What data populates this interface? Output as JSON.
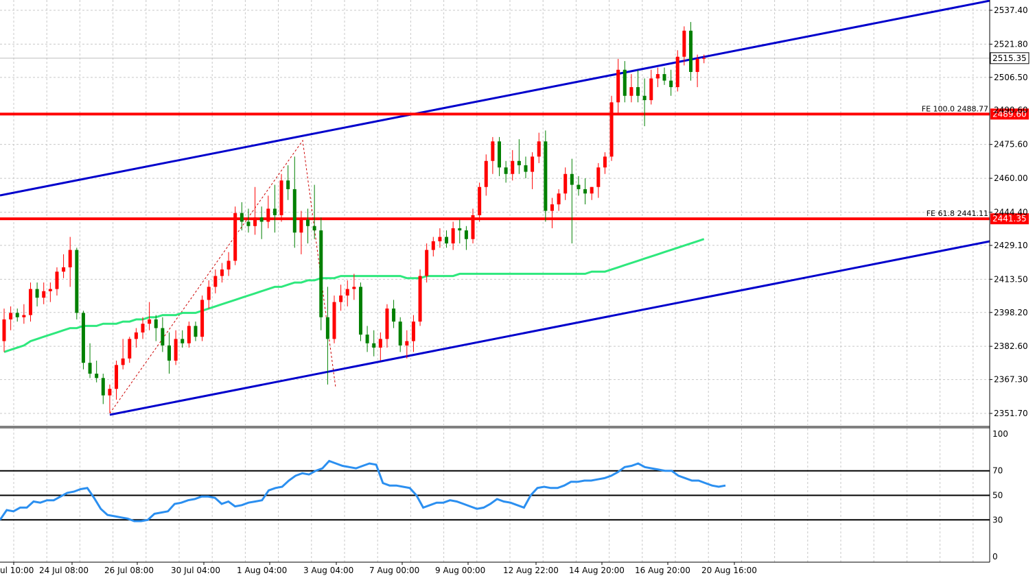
{
  "chart_data": [
    {
      "type": "candlestick",
      "symbol_panel": "price",
      "y_ticks": [
        "2537.40",
        "2521.80",
        "2506.50",
        "2475.60",
        "2460.00",
        "2444.40",
        "2429.10",
        "2413.50",
        "2398.20",
        "2382.60",
        "2367.30",
        "2351.70"
      ],
      "y_range": [
        2345,
        2543
      ],
      "x_labels": [
        "ul 10:00",
        "24 Jul 08:00",
        "26 Jul 08:00",
        "30 Jul 04:00",
        "1 Aug 04:00",
        "3 Aug 04:00",
        "7 Aug 00:00",
        "9 Aug 00:00",
        "12 Aug 22:00",
        "14 Aug 20:00",
        "16 Aug 20:00",
        "20 Aug 16:00"
      ],
      "current_price": "2515.35",
      "price_levels": [
        {
          "value": 2489.6,
          "label": "2489.60",
          "fib_label": "FE 100.0 2488.77",
          "hidden_tick": "2490.60",
          "color": "#ff0000"
        },
        {
          "value": 2441.35,
          "label": "2441.35",
          "fib_label": "FE 61.8 2441.11",
          "color": "#ff0000"
        }
      ],
      "colors": {
        "up": "#ff0000",
        "down": "#008000",
        "ma": "#2ee87d",
        "channel": "#0000cc",
        "level": "#ff0000",
        "fib_zigzag": "#cc0000"
      },
      "candles": [
        {
          "o": 2385,
          "h": 2400,
          "l": 2380,
          "c": 2395
        },
        {
          "o": 2395,
          "h": 2401,
          "l": 2390,
          "c": 2398
        },
        {
          "o": 2398,
          "h": 2400,
          "l": 2394,
          "c": 2396
        },
        {
          "o": 2396,
          "h": 2402,
          "l": 2393,
          "c": 2397
        },
        {
          "o": 2397,
          "h": 2412,
          "l": 2394,
          "c": 2409
        },
        {
          "o": 2409,
          "h": 2412,
          "l": 2401,
          "c": 2405
        },
        {
          "o": 2405,
          "h": 2412,
          "l": 2402,
          "c": 2408
        },
        {
          "o": 2408,
          "h": 2412,
          "l": 2403,
          "c": 2409
        },
        {
          "o": 2409,
          "h": 2419,
          "l": 2406,
          "c": 2417
        },
        {
          "o": 2417,
          "h": 2425,
          "l": 2414,
          "c": 2419
        },
        {
          "o": 2419,
          "h": 2433,
          "l": 2410,
          "c": 2427
        },
        {
          "o": 2427,
          "h": 2428,
          "l": 2395,
          "c": 2398
        },
        {
          "o": 2398,
          "h": 2399,
          "l": 2372,
          "c": 2375
        },
        {
          "o": 2375,
          "h": 2384,
          "l": 2368,
          "c": 2370
        },
        {
          "o": 2370,
          "h": 2376,
          "l": 2366,
          "c": 2368
        },
        {
          "o": 2368,
          "h": 2370,
          "l": 2356,
          "c": 2360
        },
        {
          "o": 2360,
          "h": 2365,
          "l": 2352,
          "c": 2363
        },
        {
          "o": 2363,
          "h": 2376,
          "l": 2358,
          "c": 2374
        },
        {
          "o": 2374,
          "h": 2386,
          "l": 2372,
          "c": 2377
        },
        {
          "o": 2377,
          "h": 2387,
          "l": 2375,
          "c": 2386
        },
        {
          "o": 2386,
          "h": 2391,
          "l": 2382,
          "c": 2389
        },
        {
          "o": 2389,
          "h": 2396,
          "l": 2386,
          "c": 2393
        },
        {
          "o": 2393,
          "h": 2403,
          "l": 2390,
          "c": 2395
        },
        {
          "o": 2395,
          "h": 2397,
          "l": 2385,
          "c": 2391
        },
        {
          "o": 2391,
          "h": 2396,
          "l": 2380,
          "c": 2383
        },
        {
          "o": 2383,
          "h": 2389,
          "l": 2370,
          "c": 2376
        },
        {
          "o": 2376,
          "h": 2390,
          "l": 2374,
          "c": 2386
        },
        {
          "o": 2386,
          "h": 2390,
          "l": 2382,
          "c": 2384
        },
        {
          "o": 2384,
          "h": 2394,
          "l": 2382,
          "c": 2392
        },
        {
          "o": 2392,
          "h": 2394,
          "l": 2385,
          "c": 2387
        },
        {
          "o": 2387,
          "h": 2406,
          "l": 2385,
          "c": 2404
        },
        {
          "o": 2404,
          "h": 2413,
          "l": 2400,
          "c": 2410
        },
        {
          "o": 2410,
          "h": 2418,
          "l": 2407,
          "c": 2415
        },
        {
          "o": 2415,
          "h": 2421,
          "l": 2412,
          "c": 2418
        },
        {
          "o": 2418,
          "h": 2426,
          "l": 2415,
          "c": 2422
        },
        {
          "o": 2422,
          "h": 2447,
          "l": 2420,
          "c": 2444
        },
        {
          "o": 2444,
          "h": 2449,
          "l": 2436,
          "c": 2440
        },
        {
          "o": 2440,
          "h": 2446,
          "l": 2435,
          "c": 2438
        },
        {
          "o": 2438,
          "h": 2456,
          "l": 2434,
          "c": 2442
        },
        {
          "o": 2442,
          "h": 2447,
          "l": 2432,
          "c": 2440
        },
        {
          "o": 2440,
          "h": 2452,
          "l": 2437,
          "c": 2446
        },
        {
          "o": 2446,
          "h": 2457,
          "l": 2435,
          "c": 2443
        },
        {
          "o": 2443,
          "h": 2462,
          "l": 2440,
          "c": 2459
        },
        {
          "o": 2459,
          "h": 2466,
          "l": 2450,
          "c": 2455
        },
        {
          "o": 2455,
          "h": 2470,
          "l": 2428,
          "c": 2435
        },
        {
          "o": 2435,
          "h": 2445,
          "l": 2425,
          "c": 2441
        },
        {
          "o": 2441,
          "h": 2446,
          "l": 2430,
          "c": 2438
        },
        {
          "o": 2438,
          "h": 2457,
          "l": 2432,
          "c": 2436
        },
        {
          "o": 2436,
          "h": 2442,
          "l": 2390,
          "c": 2396
        },
        {
          "o": 2396,
          "h": 2410,
          "l": 2365,
          "c": 2386
        },
        {
          "o": 2386,
          "h": 2406,
          "l": 2384,
          "c": 2403
        },
        {
          "o": 2403,
          "h": 2411,
          "l": 2399,
          "c": 2406
        },
        {
          "o": 2406,
          "h": 2413,
          "l": 2401,
          "c": 2409
        },
        {
          "o": 2409,
          "h": 2416,
          "l": 2404,
          "c": 2410
        },
        {
          "o": 2410,
          "h": 2412,
          "l": 2385,
          "c": 2388
        },
        {
          "o": 2388,
          "h": 2392,
          "l": 2380,
          "c": 2384
        },
        {
          "o": 2384,
          "h": 2390,
          "l": 2378,
          "c": 2382
        },
        {
          "o": 2382,
          "h": 2389,
          "l": 2376,
          "c": 2386
        },
        {
          "o": 2386,
          "h": 2402,
          "l": 2382,
          "c": 2400
        },
        {
          "o": 2400,
          "h": 2404,
          "l": 2391,
          "c": 2394
        },
        {
          "o": 2394,
          "h": 2396,
          "l": 2380,
          "c": 2383
        },
        {
          "o": 2383,
          "h": 2390,
          "l": 2377,
          "c": 2385
        },
        {
          "o": 2385,
          "h": 2397,
          "l": 2380,
          "c": 2394
        },
        {
          "o": 2394,
          "h": 2418,
          "l": 2392,
          "c": 2415
        },
        {
          "o": 2415,
          "h": 2430,
          "l": 2412,
          "c": 2427
        },
        {
          "o": 2427,
          "h": 2433,
          "l": 2424,
          "c": 2431
        },
        {
          "o": 2431,
          "h": 2437,
          "l": 2428,
          "c": 2433
        },
        {
          "o": 2433,
          "h": 2436,
          "l": 2428,
          "c": 2430
        },
        {
          "o": 2430,
          "h": 2440,
          "l": 2427,
          "c": 2437
        },
        {
          "o": 2437,
          "h": 2441,
          "l": 2430,
          "c": 2436
        },
        {
          "o": 2436,
          "h": 2438,
          "l": 2427,
          "c": 2432
        },
        {
          "o": 2432,
          "h": 2446,
          "l": 2430,
          "c": 2443
        },
        {
          "o": 2443,
          "h": 2458,
          "l": 2440,
          "c": 2456
        },
        {
          "o": 2456,
          "h": 2471,
          "l": 2452,
          "c": 2468
        },
        {
          "o": 2468,
          "h": 2479,
          "l": 2462,
          "c": 2477
        },
        {
          "o": 2477,
          "h": 2479,
          "l": 2461,
          "c": 2465
        },
        {
          "o": 2465,
          "h": 2468,
          "l": 2458,
          "c": 2462
        },
        {
          "o": 2462,
          "h": 2473,
          "l": 2459,
          "c": 2468
        },
        {
          "o": 2468,
          "h": 2478,
          "l": 2462,
          "c": 2466
        },
        {
          "o": 2466,
          "h": 2470,
          "l": 2460,
          "c": 2463
        },
        {
          "o": 2463,
          "h": 2472,
          "l": 2455,
          "c": 2470
        },
        {
          "o": 2470,
          "h": 2481,
          "l": 2467,
          "c": 2477
        },
        {
          "o": 2477,
          "h": 2482,
          "l": 2440,
          "c": 2445
        },
        {
          "o": 2445,
          "h": 2451,
          "l": 2437,
          "c": 2448
        },
        {
          "o": 2448,
          "h": 2455,
          "l": 2445,
          "c": 2453
        },
        {
          "o": 2453,
          "h": 2465,
          "l": 2450,
          "c": 2462
        },
        {
          "o": 2462,
          "h": 2469,
          "l": 2430,
          "c": 2457
        },
        {
          "o": 2457,
          "h": 2461,
          "l": 2452,
          "c": 2455
        },
        {
          "o": 2455,
          "h": 2460,
          "l": 2448,
          "c": 2453
        },
        {
          "o": 2453,
          "h": 2456,
          "l": 2450,
          "c": 2456
        },
        {
          "o": 2456,
          "h": 2467,
          "l": 2451,
          "c": 2465
        },
        {
          "o": 2465,
          "h": 2472,
          "l": 2462,
          "c": 2470
        },
        {
          "o": 2470,
          "h": 2498,
          "l": 2468,
          "c": 2495
        },
        {
          "o": 2495,
          "h": 2515,
          "l": 2490,
          "c": 2510
        },
        {
          "o": 2510,
          "h": 2514,
          "l": 2495,
          "c": 2498
        },
        {
          "o": 2498,
          "h": 2508,
          "l": 2495,
          "c": 2502
        },
        {
          "o": 2502,
          "h": 2510,
          "l": 2495,
          "c": 2498
        },
        {
          "o": 2498,
          "h": 2506,
          "l": 2484,
          "c": 2496
        },
        {
          "o": 2496,
          "h": 2510,
          "l": 2494,
          "c": 2506
        },
        {
          "o": 2506,
          "h": 2511,
          "l": 2502,
          "c": 2508
        },
        {
          "o": 2508,
          "h": 2511,
          "l": 2503,
          "c": 2505
        },
        {
          "o": 2505,
          "h": 2510,
          "l": 2498,
          "c": 2502
        },
        {
          "o": 2502,
          "h": 2519,
          "l": 2500,
          "c": 2516
        },
        {
          "o": 2516,
          "h": 2530,
          "l": 2512,
          "c": 2528
        },
        {
          "o": 2528,
          "h": 2532,
          "l": 2505,
          "c": 2509
        },
        {
          "o": 2509,
          "h": 2517,
          "l": 2502,
          "c": 2515
        },
        {
          "o": 2515,
          "h": 2517,
          "l": 2513,
          "c": 2515.35
        }
      ],
      "ma_values": [
        2380,
        2381,
        2382,
        2383,
        2385,
        2386,
        2387,
        2388,
        2389,
        2390,
        2391,
        2391,
        2392,
        2392,
        2392,
        2393,
        2393,
        2393,
        2394,
        2394,
        2395,
        2395,
        2396,
        2396,
        2397,
        2397,
        2397,
        2398,
        2398,
        2398,
        2399,
        2400,
        2401,
        2402,
        2403,
        2404,
        2405,
        2406,
        2407,
        2408,
        2409,
        2410,
        2410,
        2411,
        2412,
        2412,
        2413,
        2413,
        2414,
        2414,
        2414,
        2415,
        2415,
        2415,
        2415,
        2415,
        2415,
        2415,
        2415,
        2415,
        2415,
        2414,
        2414,
        2414,
        2415,
        2415,
        2415,
        2415,
        2415,
        2416,
        2416,
        2416,
        2416,
        2416,
        2416,
        2416,
        2416,
        2416,
        2416,
        2416,
        2416,
        2416,
        2416,
        2416,
        2416,
        2416,
        2416,
        2416,
        2416,
        2417,
        2417,
        2417,
        2418,
        2419,
        2420,
        2421,
        2422,
        2423,
        2424,
        2425,
        2426,
        2427,
        2428,
        2429,
        2430,
        2431,
        2432
      ]
    },
    {
      "type": "line",
      "symbol_panel": "oscillator",
      "y_ticks": [
        "100",
        "70",
        "50",
        "30",
        "0"
      ],
      "y_range": [
        0,
        100
      ],
      "levels": [
        70,
        50,
        30
      ],
      "line_color": "#2b8ff0",
      "values": [
        30,
        38,
        37,
        40,
        40,
        45,
        44,
        46,
        46,
        49,
        52,
        53,
        55,
        56,
        48,
        39,
        34,
        33,
        32,
        31,
        29,
        29,
        30,
        35,
        36,
        37,
        43,
        44,
        46,
        47,
        49,
        49,
        48,
        43,
        45,
        41,
        42,
        44,
        45,
        46,
        54,
        56,
        57,
        62,
        66,
        68,
        67,
        70,
        72,
        78,
        76,
        74,
        73,
        72,
        74,
        76,
        75,
        60,
        58,
        58,
        57,
        56,
        50,
        40,
        42,
        44,
        44,
        46,
        45,
        43,
        41,
        39,
        40,
        43,
        47,
        45,
        44,
        42,
        40,
        50,
        56,
        57,
        56,
        56,
        58,
        61,
        61,
        62,
        62,
        63,
        64,
        66,
        69,
        73,
        74,
        76,
        73,
        72,
        71,
        70,
        70,
        66,
        64,
        62,
        62,
        60,
        58,
        57,
        58
      ]
    }
  ]
}
